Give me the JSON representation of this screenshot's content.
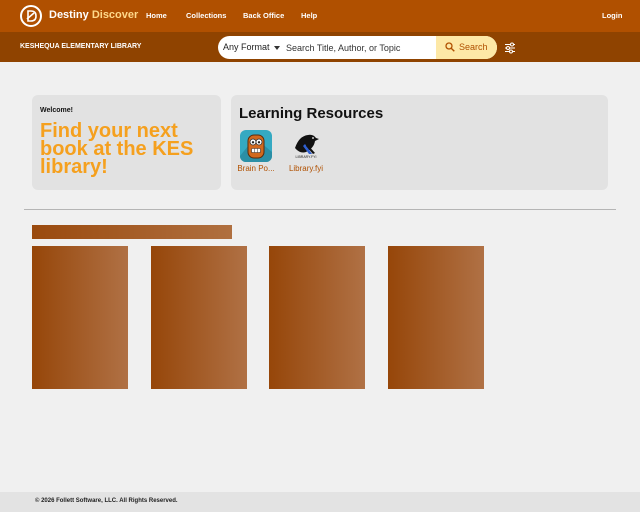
{
  "header": {
    "brand_part1": "Destiny",
    "brand_part2": "Discover",
    "nav": [
      "Home",
      "Collections",
      "Back Office",
      "Help"
    ],
    "login": "Login"
  },
  "subheader": {
    "library_name": "KESHEQUA ELEMENTARY LIBRARY",
    "format": "Any Format",
    "search_placeholder": "Search Title, Author, or Topic",
    "search_button": "Search"
  },
  "welcome": {
    "label": "Welcome!",
    "message": "Find your next book at the KES library!"
  },
  "resources": {
    "title": "Learning Resources",
    "items": [
      {
        "label": "Brain Po...",
        "icon": "brainpop-robot-icon"
      },
      {
        "label": "Library.fyi",
        "icon": "library-fyi-bird-icon",
        "logo_text": "LIBRARY.FYI"
      }
    ]
  },
  "footer": {
    "copyright": "© 2026 Follett Software, LLC. All Rights Reserved."
  },
  "colors": {
    "header": "#b05000",
    "subheader": "#8f4300",
    "accent": "#f5a01e",
    "link": "#b05000"
  }
}
